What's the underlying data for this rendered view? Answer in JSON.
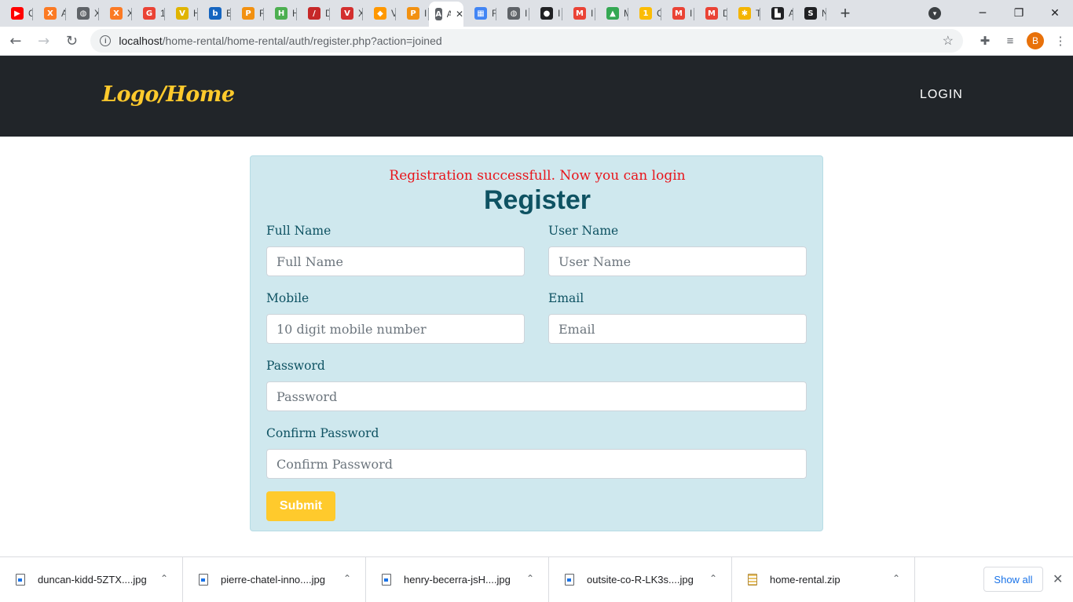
{
  "browser": {
    "tabs": [
      {
        "icon": "youtube-icon",
        "color": "#ff0000",
        "glyph": "▶",
        "title": "C"
      },
      {
        "icon": "xampp-icon",
        "color": "#fb7a24",
        "glyph": "X",
        "title": "A"
      },
      {
        "icon": "globe-icon",
        "color": "#5f6368",
        "glyph": "◍",
        "title": "X"
      },
      {
        "icon": "xampp-icon",
        "color": "#fb7a24",
        "glyph": "X",
        "title": "X"
      },
      {
        "icon": "google-icon",
        "color": "#ea4335",
        "glyph": "G",
        "title": "1"
      },
      {
        "icon": "bookmark-icon",
        "color": "#e0b400",
        "glyph": "V",
        "title": "H"
      },
      {
        "icon": "bootstrap-icon",
        "color": "#1565c0",
        "glyph": "b",
        "title": "E"
      },
      {
        "icon": "phpmyadmin-icon",
        "color": "#f29111",
        "glyph": "P",
        "title": "F"
      },
      {
        "icon": "app-icon",
        "color": "#4caf50",
        "glyph": "H",
        "title": "H"
      },
      {
        "icon": "pen-icon",
        "color": "#c62828",
        "glyph": "/",
        "title": "D"
      },
      {
        "icon": "v-icon",
        "color": "#d32f2f",
        "glyph": "V",
        "title": "X"
      },
      {
        "icon": "diamond-icon",
        "color": "#ff9800",
        "glyph": "◆",
        "title": "V"
      },
      {
        "icon": "phpmyadmin-icon",
        "color": "#f29111",
        "glyph": "P",
        "title": "I"
      },
      {
        "icon": "tab-icon",
        "color": "#5f6368",
        "glyph": "A",
        "title": "A",
        "active": true
      },
      {
        "icon": "grid-icon",
        "color": "#4285f4",
        "glyph": "▦",
        "title": "F"
      },
      {
        "icon": "globe-icon",
        "color": "#5f6368",
        "glyph": "◍",
        "title": "I"
      },
      {
        "icon": "github-icon",
        "color": "#202124",
        "glyph": "●",
        "title": "I"
      },
      {
        "icon": "gmail-icon",
        "color": "#ea4335",
        "glyph": "M",
        "title": "I"
      },
      {
        "icon": "drive-icon",
        "color": "#34a853",
        "glyph": "▲",
        "title": "M"
      },
      {
        "icon": "google-icon",
        "color": "#fbbc05",
        "glyph": "1",
        "title": "C"
      },
      {
        "icon": "gmail-icon",
        "color": "#ea4335",
        "glyph": "M",
        "title": "I"
      },
      {
        "icon": "gmail-icon",
        "color": "#ea4335",
        "glyph": "M",
        "title": "D"
      },
      {
        "icon": "pinwheel-icon",
        "color": "#f4b400",
        "glyph": "✱",
        "title": "T"
      },
      {
        "icon": "app-icon",
        "color": "#202124",
        "glyph": "▙",
        "title": "A"
      },
      {
        "icon": "app-icon",
        "color": "#202124",
        "glyph": "S",
        "title": "N"
      }
    ],
    "url_host": "localhost",
    "url_path": "/home-rental/home-rental/auth/register.php?action=joined",
    "profile_initial": "B"
  },
  "navbar": {
    "brand": "Logo/Home",
    "login": "LOGIN"
  },
  "form": {
    "alert": "Registration successfull. Now you can login",
    "title": "Register",
    "full_name_label": "Full Name",
    "full_name_placeholder": "Full Name",
    "user_name_label": "User Name",
    "user_name_placeholder": "User Name",
    "mobile_label": "Mobile",
    "mobile_placeholder": "10 digit mobile number",
    "email_label": "Email",
    "email_placeholder": "Email",
    "password_label": "Password",
    "password_placeholder": "Password",
    "confirm_label": "Confirm Password",
    "confirm_placeholder": "Confirm Password",
    "submit": "Submit"
  },
  "downloads": {
    "items": [
      {
        "name": "duncan-kidd-5ZTX....jpg",
        "type": "image"
      },
      {
        "name": "pierre-chatel-inno....jpg",
        "type": "image"
      },
      {
        "name": "henry-becerra-jsH....jpg",
        "type": "image"
      },
      {
        "name": "outsite-co-R-LK3s....jpg",
        "type": "image"
      },
      {
        "name": "home-rental.zip",
        "type": "zip"
      }
    ],
    "show_all": "Show all"
  },
  "colors": {
    "navbar_bg": "#212529",
    "brand": "#ffca2c",
    "card_bg": "#cfe8ee",
    "heading": "#0e5262",
    "alert": "#e8151b",
    "button": "#ffca2c"
  }
}
